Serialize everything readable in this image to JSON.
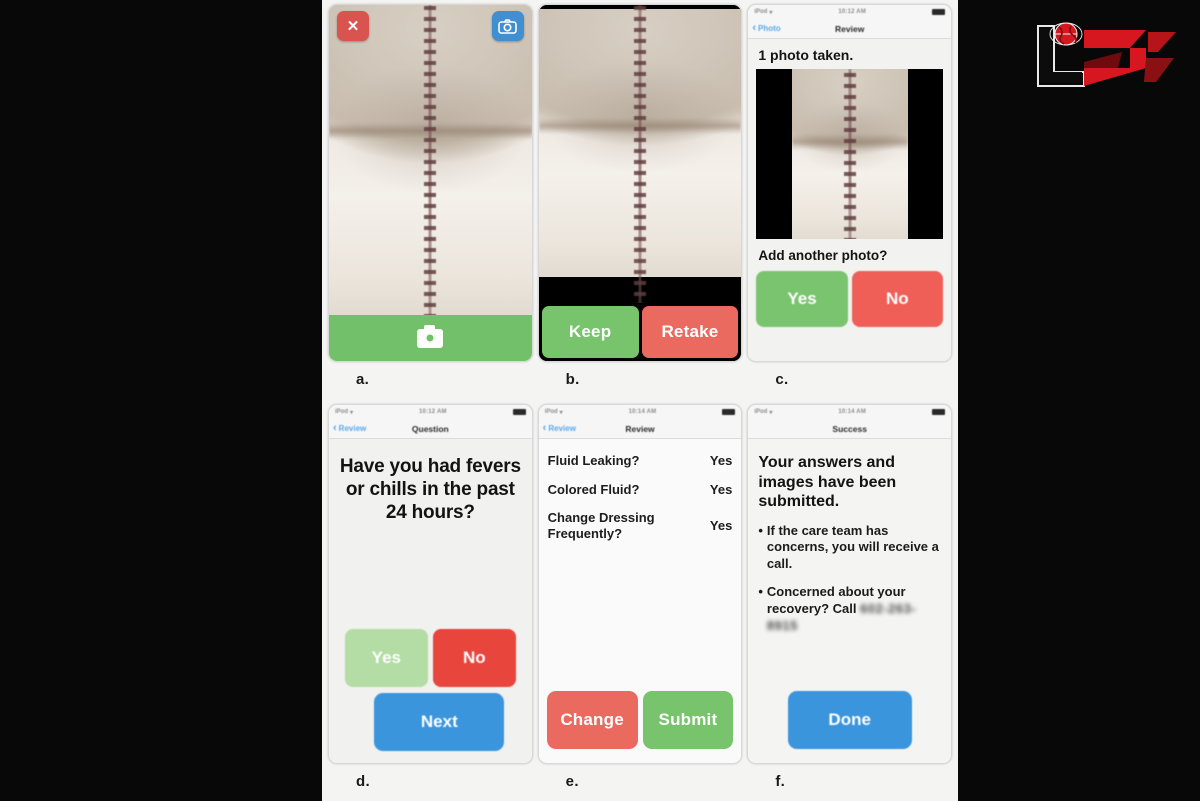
{
  "figure": {
    "background_color": "#080808",
    "sheet_color": "#f4f4f2",
    "panels": [
      {
        "caption": "a.",
        "type": "camera-capture",
        "close_icon": "close-icon",
        "flip_icon": "camera-flip-icon",
        "shutter_icon": "camera-icon"
      },
      {
        "caption": "b.",
        "type": "photo-confirm",
        "keep_label": "Keep",
        "retake_label": "Retake"
      },
      {
        "caption": "c.",
        "type": "photo-review",
        "statusbar": {
          "carrier": "iPod",
          "wifi_icon": "wifi-icon",
          "time": "10:12 AM",
          "battery_icon": "battery-icon"
        },
        "nav": {
          "back_label": "Photo",
          "title": "Review",
          "back_icon": "chevron-left-icon"
        },
        "heading": "1 photo taken.",
        "question": "Add another photo?",
        "yes_label": "Yes",
        "no_label": "No"
      },
      {
        "caption": "d.",
        "type": "question",
        "statusbar": {
          "carrier": "iPod",
          "wifi_icon": "wifi-icon",
          "time": "10:12 AM",
          "battery_icon": "battery-icon"
        },
        "nav": {
          "back_label": "Review",
          "title": "Question",
          "back_icon": "chevron-left-icon"
        },
        "question": "Have you had fevers or chills in the past 24 hours?",
        "yes_label": "Yes",
        "no_label": "No",
        "next_label": "Next"
      },
      {
        "caption": "e.",
        "type": "answer-review",
        "statusbar": {
          "carrier": "iPod",
          "wifi_icon": "wifi-icon",
          "time": "10:14 AM",
          "battery_icon": "battery-icon"
        },
        "nav": {
          "back_label": "Review",
          "title": "Review",
          "back_icon": "chevron-left-icon"
        },
        "rows": [
          {
            "question": "Fluid Leaking?",
            "answer": "Yes"
          },
          {
            "question": "Colored Fluid?",
            "answer": "Yes"
          },
          {
            "question": "Change Dressing Frequently?",
            "answer": "Yes"
          }
        ],
        "change_label": "Change",
        "submit_label": "Submit"
      },
      {
        "caption": "f.",
        "type": "success",
        "statusbar": {
          "carrier": "iPod",
          "wifi_icon": "wifi-icon",
          "time": "10:14 AM",
          "battery_icon": "battery-icon"
        },
        "nav": {
          "title": "Success"
        },
        "heading": "Your answers and images have been submitted.",
        "bullets": [
          {
            "marker": "•",
            "text": "If the care team has concerns, you will receive a call."
          },
          {
            "marker": "•",
            "text": "Concerned about your recovery?  Call"
          }
        ],
        "phone_number": "602-263-8915",
        "done_label": "Done"
      }
    ]
  },
  "watermark": {
    "name": "lsa-news-logo",
    "primary_color": "#d6171f",
    "dark_color": "#8a1014",
    "globe_icon": "globe-icon"
  },
  "colors": {
    "green": "#77c46d",
    "light_green": "#b3dda5",
    "red": "#eb6a60",
    "bright_red": "#e8453d",
    "blue": "#3b95dd",
    "nav_blue": "#5aa8e8"
  }
}
